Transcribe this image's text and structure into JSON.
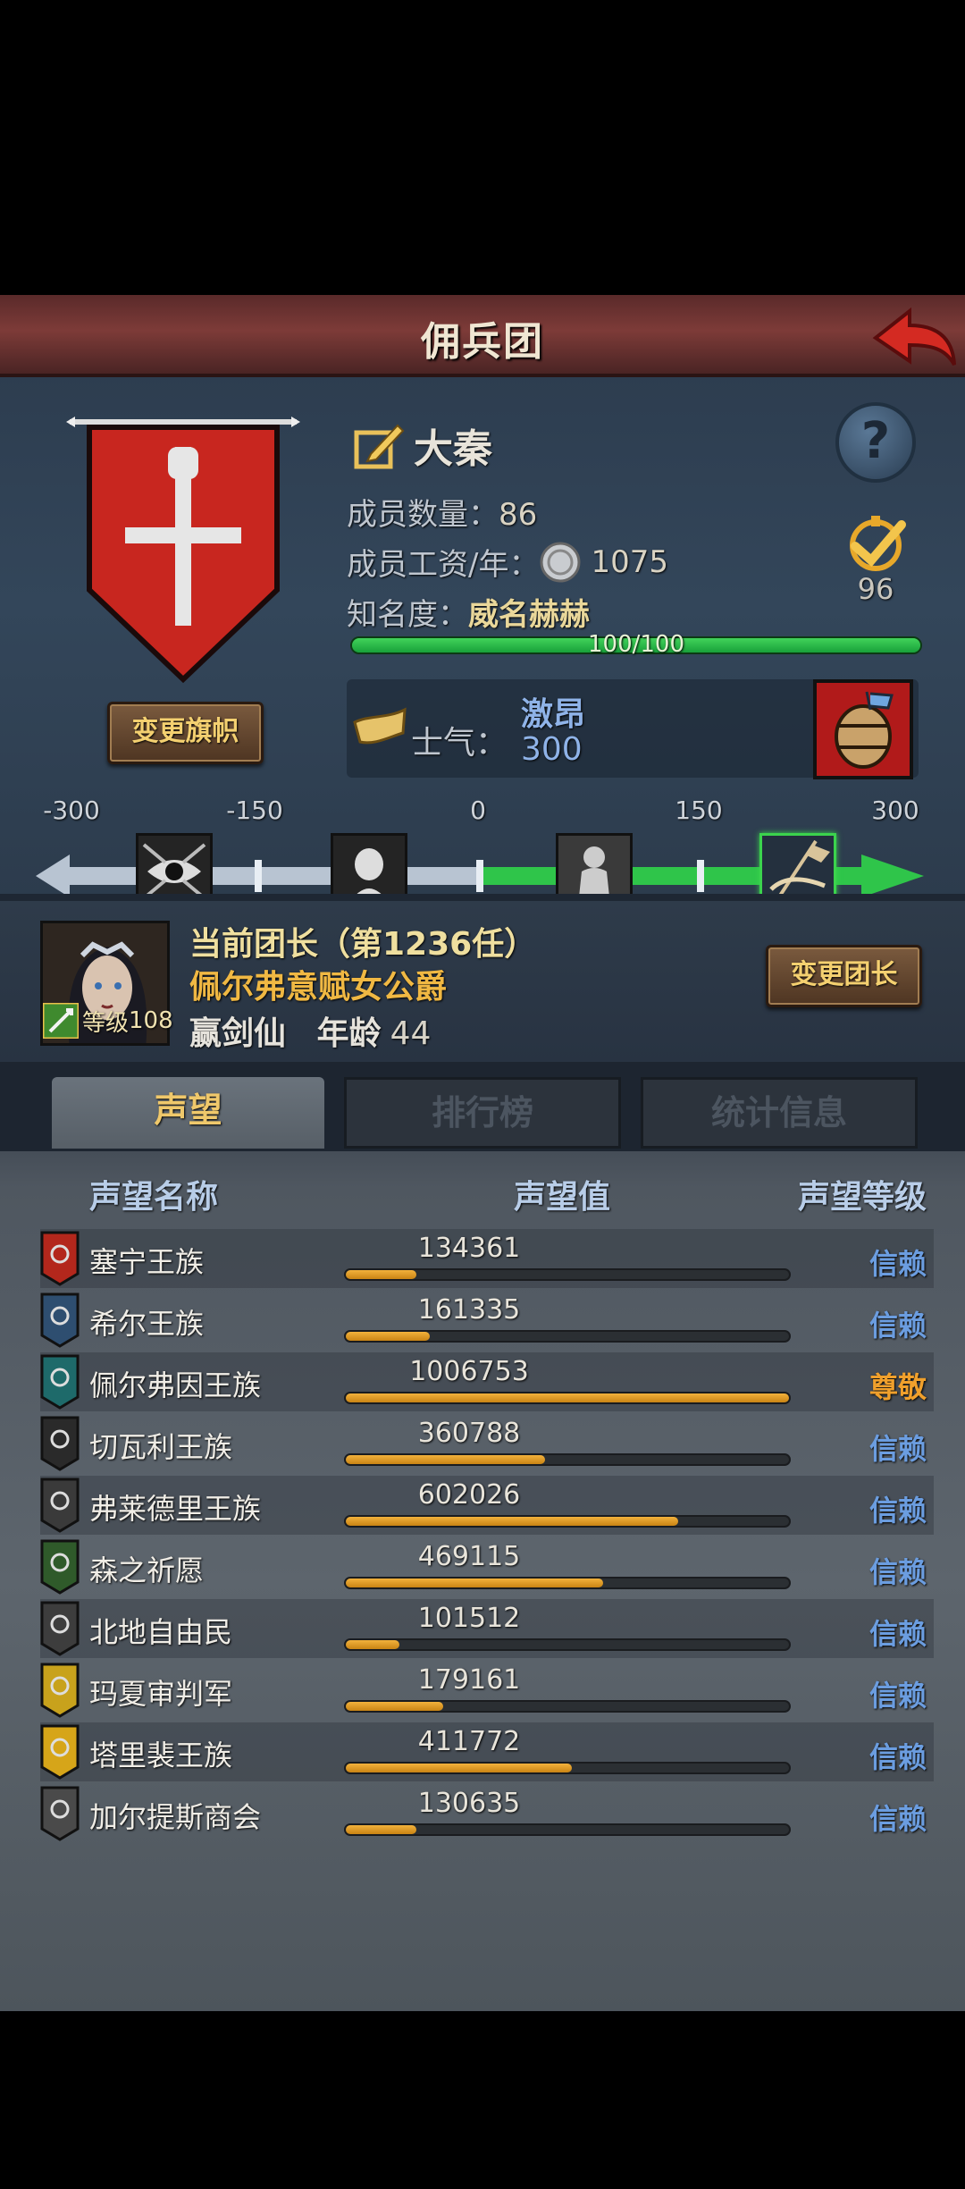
{
  "header": {
    "title": "佣兵团"
  },
  "guild": {
    "name": "大秦",
    "member_count_label": "成员数量：",
    "member_count": "86",
    "salary_label": "成员工资/年：",
    "salary": "1075",
    "fame_label": "知名度：",
    "fame_value": "威名赫赫",
    "fame_progress_text": "100/100",
    "fame_progress": 1.0,
    "rank": "96",
    "change_banner_label": "变更旗帜"
  },
  "morale": {
    "label": "士气：",
    "state": "激昂",
    "value": "300",
    "scale_labels": [
      "-300",
      "-150",
      "0",
      "150",
      "300"
    ],
    "current": 300
  },
  "leader": {
    "title": "当前团长（第1236任）",
    "name": "佩尔弗意赋女公爵",
    "class": "赢剑仙",
    "age_label": "年龄",
    "age": "44",
    "level_label": "等级",
    "level": "108",
    "change_leader_label": "变更团长"
  },
  "tabs": [
    {
      "label": "声望"
    },
    {
      "label": "排行榜"
    },
    {
      "label": "统计信息"
    }
  ],
  "reputation": {
    "col_name": "声望名称",
    "col_value": "声望值",
    "col_level": "声望等级",
    "rows": [
      {
        "name": "塞宁王族",
        "value": "134361",
        "fill": 0.16,
        "level": "信赖",
        "color": "#b3271c"
      },
      {
        "name": "希尔王族",
        "value": "161335",
        "fill": 0.19,
        "level": "信赖",
        "color": "#2e4e70"
      },
      {
        "name": "佩尔弗因王族",
        "value": "1006753",
        "fill": 1.0,
        "level": "尊敬",
        "color": "#1e6a6a"
      },
      {
        "name": "切瓦利王族",
        "value": "360788",
        "fill": 0.45,
        "level": "信赖",
        "color": "#2a2a2a"
      },
      {
        "name": "弗莱德里王族",
        "value": "602026",
        "fill": 0.75,
        "level": "信赖",
        "color": "#3a3a3a"
      },
      {
        "name": "森之祈愿",
        "value": "469115",
        "fill": 0.58,
        "level": "信赖",
        "color": "#2f5a2a"
      },
      {
        "name": "北地自由民",
        "value": "101512",
        "fill": 0.12,
        "level": "信赖",
        "color": "#3d3d3d"
      },
      {
        "name": "玛夏审判军",
        "value": "179161",
        "fill": 0.22,
        "level": "信赖",
        "color": "#c8a21c"
      },
      {
        "name": "塔里裴王族",
        "value": "411772",
        "fill": 0.51,
        "level": "信赖",
        "color": "#d6a519"
      },
      {
        "name": "加尔提斯商会",
        "value": "130635",
        "fill": 0.16,
        "level": "信赖",
        "color": "#4a4a4a"
      }
    ]
  }
}
